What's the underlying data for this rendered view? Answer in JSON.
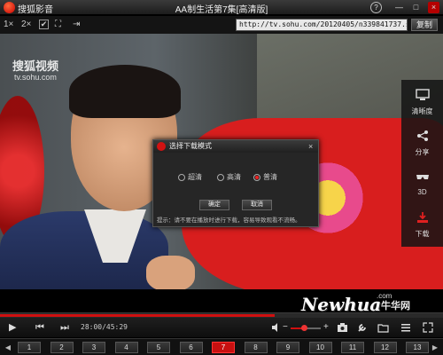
{
  "titlebar": {
    "app_name": "搜狐影音",
    "title": "AA制生活第7集[高清版]",
    "help": "?",
    "minimize": "—",
    "maximize": "□",
    "close": "×"
  },
  "toolbar": {
    "speed_1x": "1×",
    "speed_2x": "2×",
    "check": "✔",
    "fullscreen": "⛶",
    "pin": "⇥",
    "url": "http://tv.sohu.com/20120405/n339841737.shtml",
    "copy_label": "复制"
  },
  "video": {
    "watermark": "搜狐视频",
    "watermark_url": "tv.sohu.com"
  },
  "side_panel": [
    {
      "icon": "monitor-icon",
      "label": "清晰度"
    },
    {
      "icon": "share-icon",
      "label": "分享"
    },
    {
      "icon": "3d-glasses-icon",
      "label": "3D"
    },
    {
      "icon": "download-icon",
      "label": "下载"
    }
  ],
  "dialog": {
    "title": "选择下载模式",
    "close": "×",
    "options": [
      "超清",
      "高清",
      "普清"
    ],
    "selected": "普清",
    "ok_label": "确定",
    "cancel_label": "取消",
    "tip": "提示：请不要在播放时进行下载，容易导致观看不流畅。"
  },
  "brand_watermark": {
    "text": "Newhua",
    "dotcom": ".com",
    "cn": "牛华网"
  },
  "controls": {
    "play": "▶",
    "prev": "⏮",
    "next": "⏭",
    "time": "28:00/45:29",
    "progress_fraction": 0.62,
    "volume_fraction": 0.45,
    "volume_minus": "−",
    "volume_plus": "+"
  },
  "episodes": {
    "prev_arrow": "◀",
    "next_arrow": "▶",
    "items": [
      "1",
      "2",
      "3",
      "4",
      "5",
      "6",
      "7",
      "8",
      "9",
      "10",
      "11",
      "12",
      "13"
    ],
    "active": "7"
  },
  "colors": {
    "accent": "#d01010",
    "panel": "#1a1a1a"
  }
}
